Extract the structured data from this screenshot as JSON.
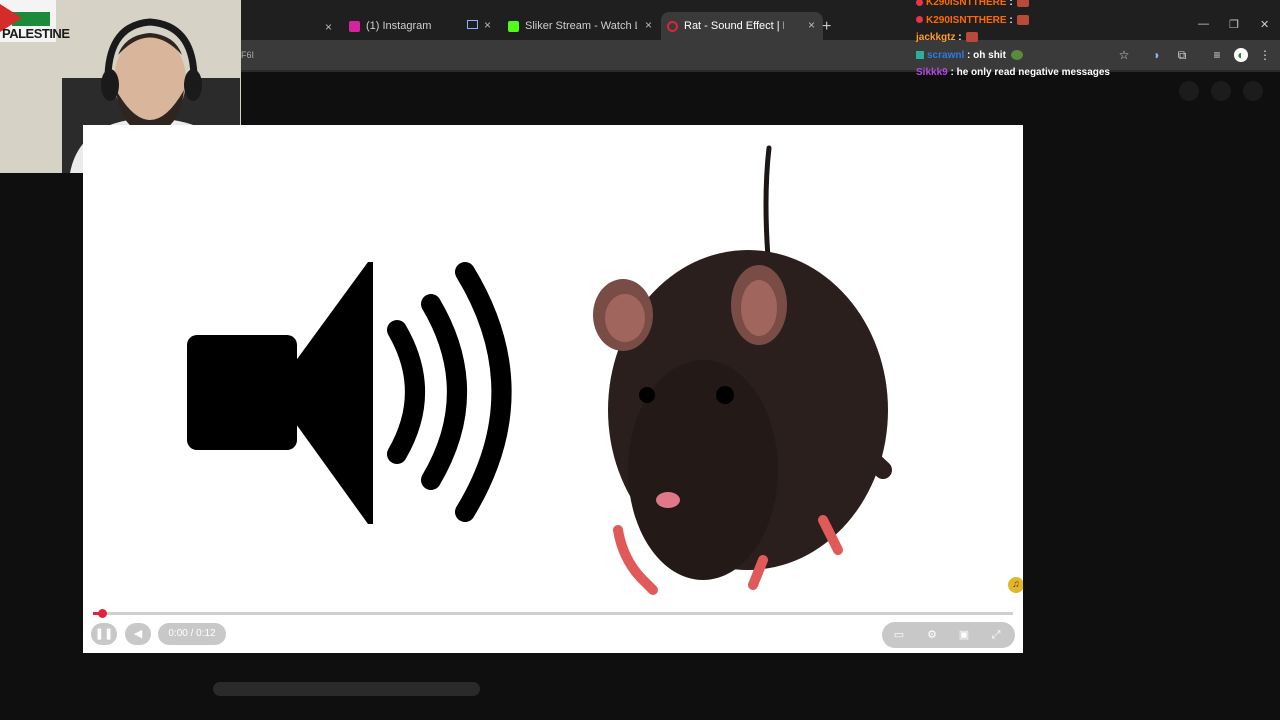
{
  "browser": {
    "tabs": [
      {
        "label": "(1) Instagram",
        "color": "#d6249f"
      },
      {
        "label": "Sliker Stream - Watch Live on K",
        "color": "#53fc18"
      },
      {
        "label": "Rat - Sound Effect | ProSou",
        "color": "#e0223a",
        "active": true
      }
    ],
    "new_tab": "+",
    "url_fragment": "F6I"
  },
  "chat": [
    {
      "user": "K290ISNTTHERE",
      "user_color": "#ff6a00",
      "text": "",
      "emote": true
    },
    {
      "user": "K290ISNTTHERE",
      "user_color": "#ff6a00",
      "text": "",
      "emote": true
    },
    {
      "user": "jackkgtz",
      "user_color": "#ff9c2b",
      "text": "",
      "emote": true
    },
    {
      "user": "scrawnl",
      "user_color": "#2d7be0",
      "text": "oh shit",
      "emote": true
    },
    {
      "user": "Sikkk9",
      "user_color": "#b04be8",
      "text": "he only read negative messages",
      "emote": false
    }
  ],
  "webcam": {
    "sign_text": "PALESTINE"
  },
  "video": {
    "time_display": "0:00 / 0:12",
    "progress": 0.01
  }
}
